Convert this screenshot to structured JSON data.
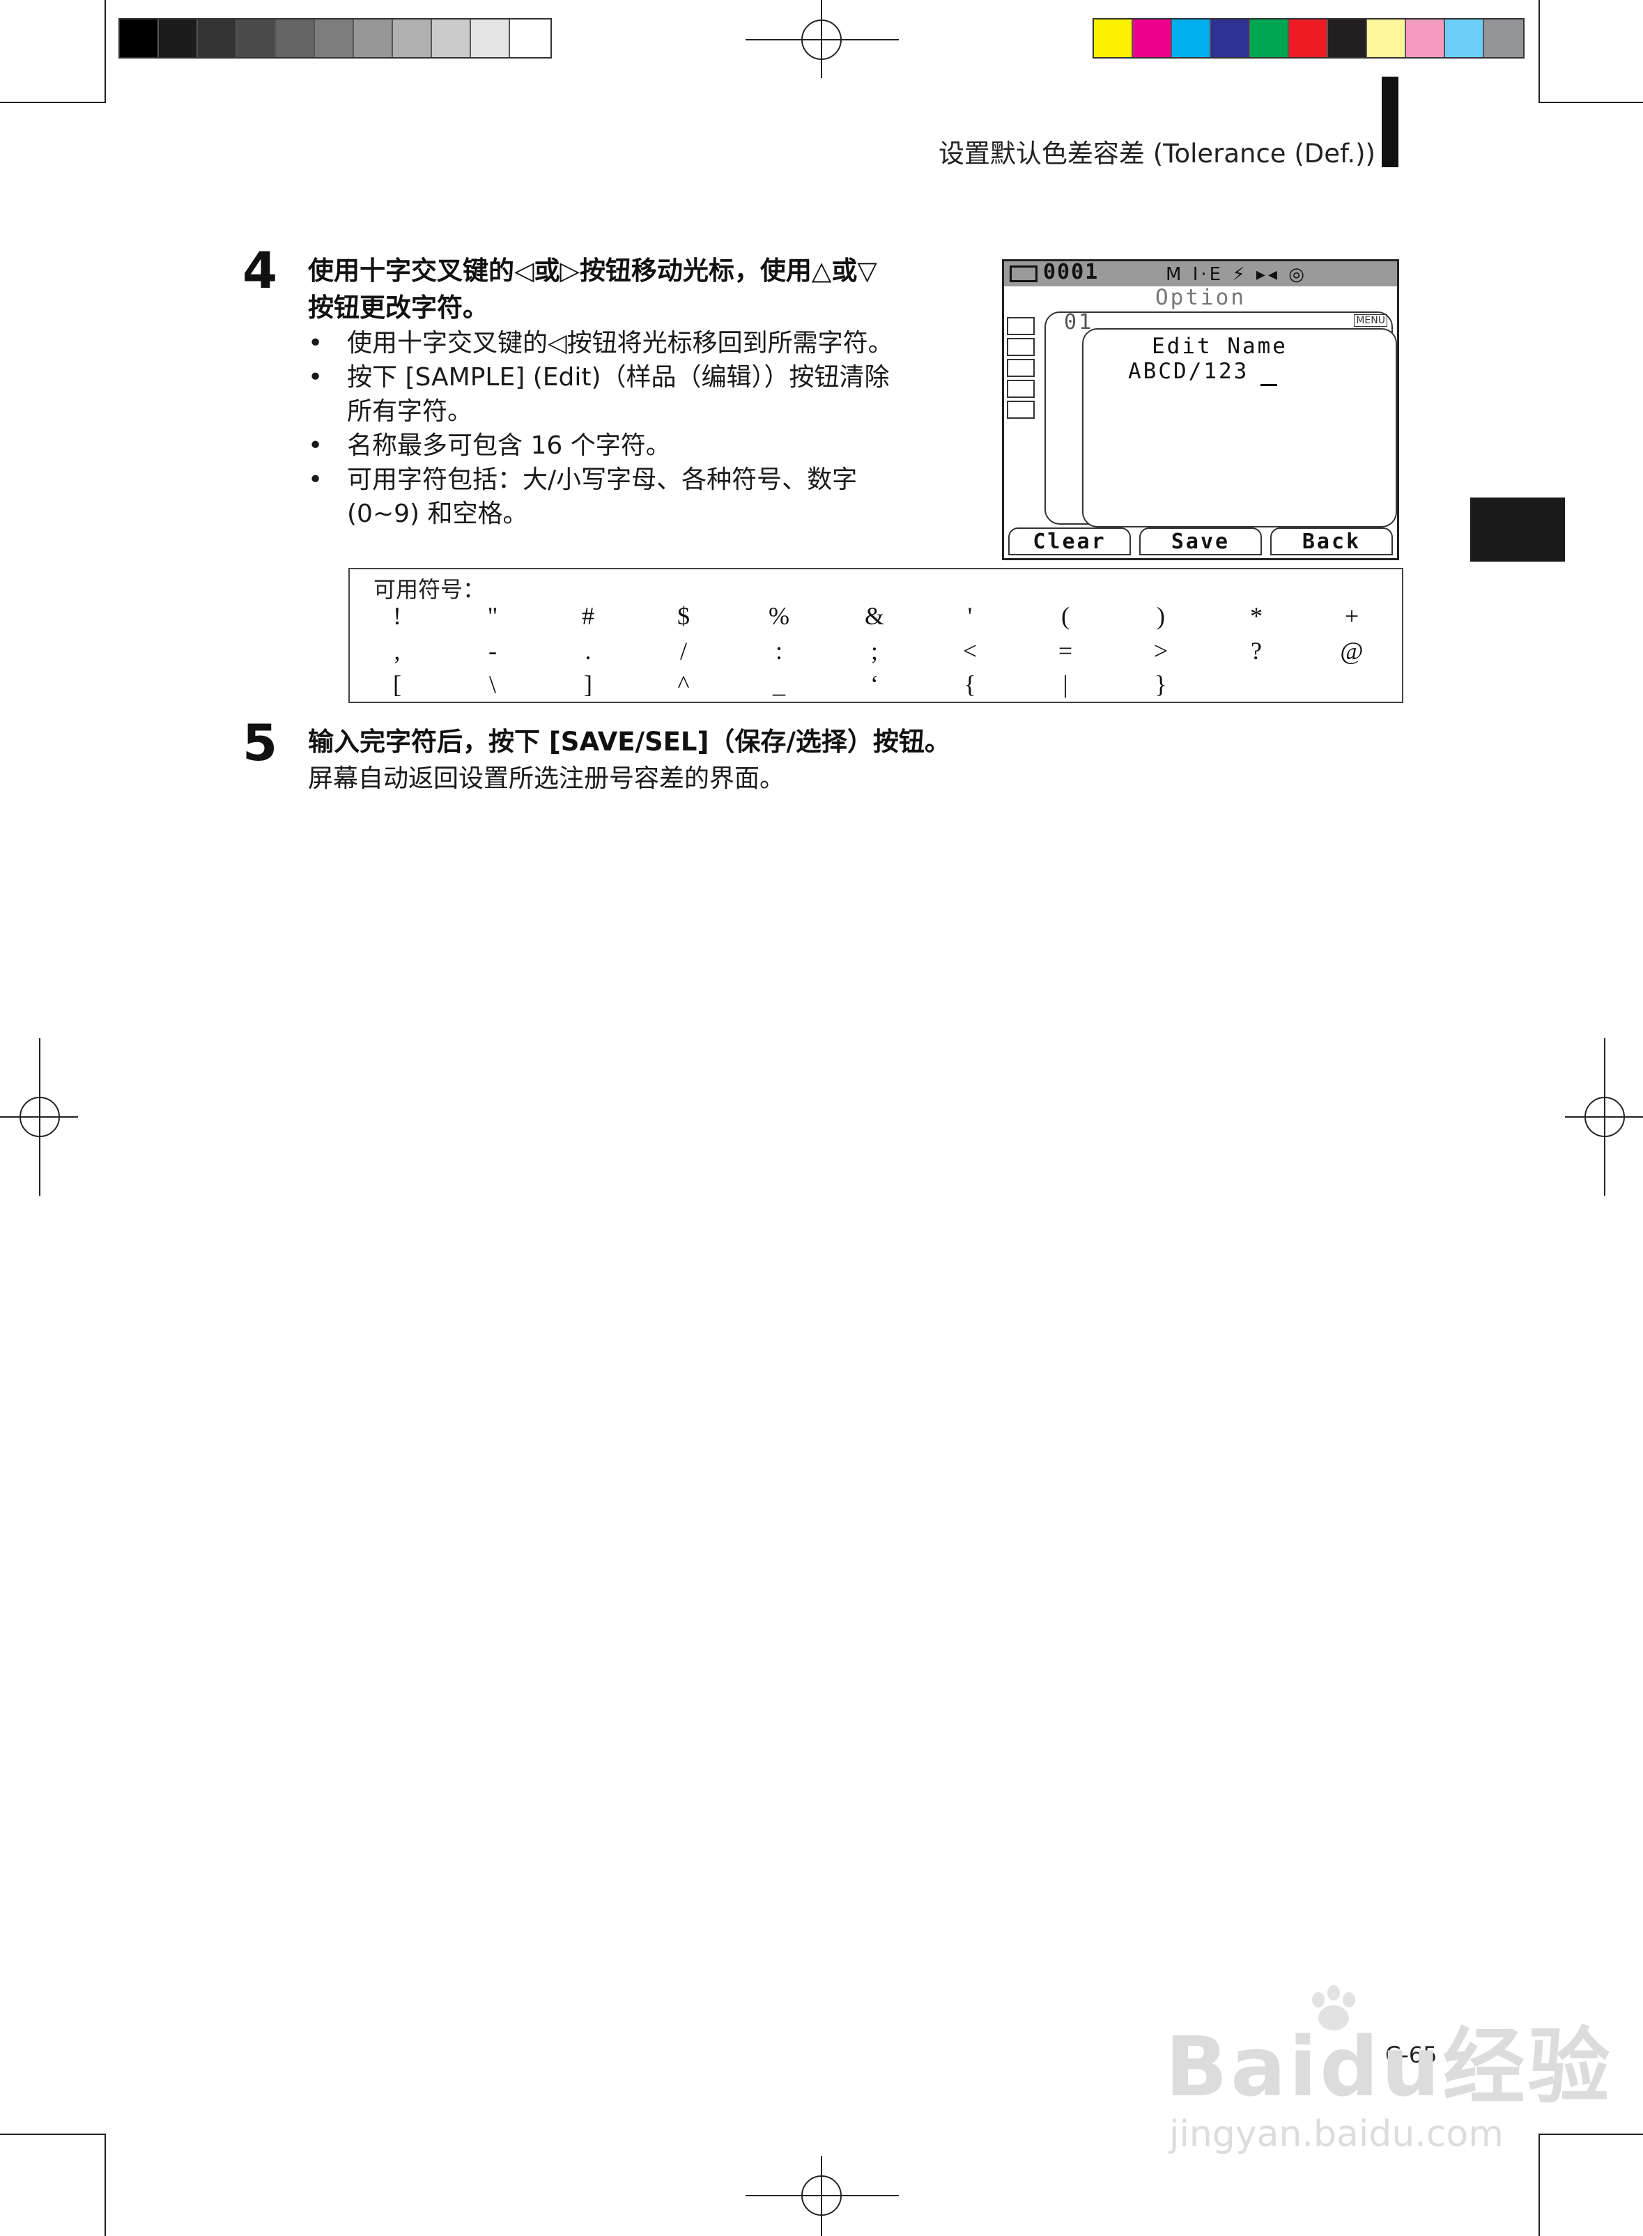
{
  "header": {
    "title": "设置默认色差容差 (Tolerance (Def.))"
  },
  "print_marks": {
    "gray_swatches": [
      "#000000",
      "#1c1c1c",
      "#333333",
      "#4a4a4a",
      "#646464",
      "#7d7d7d",
      "#979797",
      "#b0b0b0",
      "#cacaca",
      "#e4e4e4",
      "#ffffff"
    ],
    "color_swatches": [
      "#fff200",
      "#ec008c",
      "#00aeef",
      "#2e3192",
      "#00a651",
      "#ed1c24",
      "#231f20",
      "#fff799",
      "#f49ac1",
      "#6dcff6",
      "#939598"
    ]
  },
  "step4": {
    "number": "4",
    "title_line1": "使用十字交叉键的◁或▷按钮移动光标，使用△或▽",
    "title_line2": "按钮更改字符。",
    "bullets": [
      "使用十字交叉键的◁按钮将光标移回到所需字符。",
      "按下 [SAMPLE] (Edit)（样品（编辑））按钮清除",
      "所有字符。",
      "名称最多可包含 16 个字符。",
      "可用字符包括：大/小写字母、各种符号、数字",
      "(0~9) 和空格。"
    ]
  },
  "device": {
    "status_id": "0001",
    "status_icons": "M I·E ⚡ ▸◂ ◎",
    "screen_title": "Option",
    "record_id": "01",
    "menu_label": "MENU",
    "edit_title": "Edit Name",
    "name_value": "ABCD/123",
    "softkeys": [
      "Clear",
      "Save",
      "Back"
    ]
  },
  "symbols": {
    "label": "可用符号：",
    "rows": [
      [
        "!",
        "\"",
        "#",
        "$",
        "%",
        "&",
        "'",
        "(",
        ")",
        "*",
        "+"
      ],
      [
        ",",
        "-",
        ".",
        "/",
        ":",
        ";",
        "<",
        "=",
        ">",
        "?",
        "@"
      ],
      [
        "[",
        "\\",
        "]",
        "^",
        "_",
        "‘",
        "{",
        "|",
        "}"
      ]
    ]
  },
  "step5": {
    "number": "5",
    "title": "输入完字符后，按下 [SAVE/SEL]（保存/选择）按钮。",
    "body": "屏幕自动返回设置所选注册号容差的界面。"
  },
  "footer": {
    "page_number": "C-65"
  },
  "watermark": {
    "main": "Baidu经验",
    "sub": "jingyan.baidu.com"
  }
}
